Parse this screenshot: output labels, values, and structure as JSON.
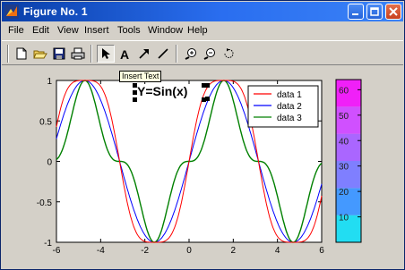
{
  "window": {
    "title": "Figure No. 1"
  },
  "menu": [
    "File",
    "Edit",
    "View",
    "Insert",
    "Tools",
    "Window",
    "Help"
  ],
  "toolbar": {
    "buttons": [
      "new-icon",
      "open-icon",
      "save-icon",
      "print-icon",
      "arrow-select-icon",
      "text-icon",
      "arrow-icon",
      "line-icon",
      "zoom-in-icon",
      "zoom-out-icon",
      "rotate-icon"
    ],
    "tooltip": "Insert Text"
  },
  "colors": {
    "titlebar": "#0a3fa8",
    "data1": "#ff0000",
    "data2": "#0000ff",
    "data3": "#008000"
  },
  "chart_data": [
    {
      "type": "line",
      "title": "Y=Sin(x)",
      "x_ticks": [
        "-6",
        "-4",
        "-2",
        "0",
        "2",
        "4",
        "6"
      ],
      "y_ticks": [
        "-1",
        "-0.5",
        "0",
        "0.5",
        "1"
      ],
      "xlim": [
        -6,
        6
      ],
      "ylim": [
        -1,
        1
      ],
      "legend_position": "top-right",
      "series": [
        {
          "name": "data 1",
          "function": "sin(sin(x)·π/2)",
          "x": [
            -6,
            -5,
            -4,
            -3,
            -2,
            -1,
            0,
            1,
            2,
            3,
            4,
            5,
            6
          ],
          "y": [
            0.43,
            0.99,
            0.92,
            -0.22,
            -0.99,
            -0.97,
            0,
            0.97,
            0.99,
            0.22,
            -0.92,
            -0.99,
            -0.43
          ]
        },
        {
          "name": "data 2",
          "function": "sin(x)",
          "x": [
            -6,
            -5,
            -4,
            -3,
            -2,
            -1,
            0,
            1,
            2,
            3,
            4,
            5,
            6
          ],
          "y": [
            0.28,
            0.96,
            0.76,
            -0.14,
            -0.91,
            -0.84,
            0,
            0.84,
            0.91,
            0.14,
            -0.76,
            -0.96,
            -0.28
          ]
        },
        {
          "name": "data 3",
          "function": "sin³(x)",
          "x": [
            -6,
            -5,
            -4,
            -3,
            -2,
            -1,
            0,
            1,
            2,
            3,
            4,
            5,
            6
          ],
          "y": [
            0.02,
            0.88,
            0.44,
            0,
            -0.75,
            -0.6,
            0,
            0.6,
            0.75,
            0,
            -0.44,
            -0.88,
            -0.02
          ]
        }
      ]
    },
    {
      "type": "heatmap",
      "title": "",
      "colorbar_ticks": [
        "10",
        "20",
        "30",
        "40",
        "50",
        "60"
      ],
      "range": [
        0,
        64
      ],
      "colors": [
        "#22ddf2",
        "#4499ff",
        "#7f7fff",
        "#aa66ff",
        "#d050ff",
        "#f020f8"
      ]
    }
  ]
}
